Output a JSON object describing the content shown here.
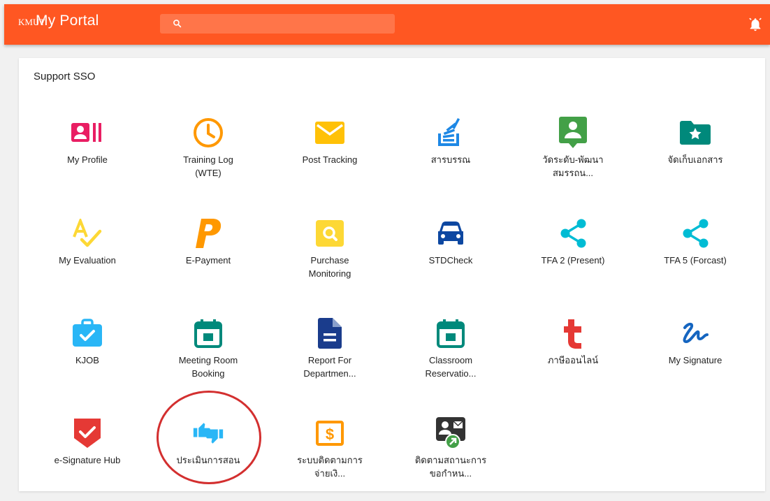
{
  "app": {
    "logo_mark": "KMUT",
    "title": "My Portal",
    "brand_color": "#ff5722"
  },
  "search": {
    "placeholder": ""
  },
  "section": {
    "title": "Support SSO"
  },
  "tiles": [
    {
      "l1": "My Profile",
      "l2": "",
      "icon": "profile-card-icon",
      "color": "#e91e63"
    },
    {
      "l1": "Training Log",
      "l2": "(WTE)",
      "icon": "clock-icon",
      "color": "#ff9800"
    },
    {
      "l1": "Post Tracking",
      "l2": "",
      "icon": "mail-icon",
      "color": "#ffc107"
    },
    {
      "l1": "สารบรรณ",
      "l2": "",
      "icon": "stack-icon",
      "color": "#1e88e5"
    },
    {
      "l1": "วัดระดับ-พัฒนา",
      "l2": "สมรรถน...",
      "icon": "person-pin-icon",
      "color": "#43a047"
    },
    {
      "l1": "จัดเก็บเอกสาร",
      "l2": "",
      "icon": "star-folder-icon",
      "color": "#00897b"
    },
    {
      "l1": "My Evaluation",
      "l2": "",
      "icon": "spellcheck-icon",
      "color": "#fdd835"
    },
    {
      "l1": "E-Payment",
      "l2": "",
      "icon": "p-letter-icon",
      "color": "#ff9800"
    },
    {
      "l1": "Purchase",
      "l2": "Monitoring",
      "icon": "search-box-icon",
      "color": "#fdd835"
    },
    {
      "l1": "STDCheck",
      "l2": "",
      "icon": "car-icon",
      "color": "#0d47a1"
    },
    {
      "l1": "TFA 2 (Present)",
      "l2": "",
      "icon": "share-icon",
      "color": "#00bcd4"
    },
    {
      "l1": "TFA 5 (Forcast)",
      "l2": "",
      "icon": "share-icon",
      "color": "#00bcd4"
    },
    {
      "l1": "KJOB",
      "l2": "",
      "icon": "briefcase-check-icon",
      "color": "#29b6f6"
    },
    {
      "l1": "Meeting Room",
      "l2": "Booking",
      "icon": "calendar-icon",
      "color": "#00897b"
    },
    {
      "l1": "Report For",
      "l2": "Departmen...",
      "icon": "document-icon",
      "color": "#1a3c8c"
    },
    {
      "l1": "Classroom",
      "l2": "Reservatio...",
      "icon": "calendar-icon",
      "color": "#00897b"
    },
    {
      "l1": "ภาษีออนไลน์",
      "l2": "",
      "icon": "t-letter-icon",
      "color": "#e53935"
    },
    {
      "l1": "My Signature",
      "l2": "",
      "icon": "signature-icon",
      "color": "#1565c0"
    },
    {
      "l1": "e-Signature Hub",
      "l2": "",
      "icon": "shield-check-icon",
      "color": "#e53935"
    },
    {
      "l1": "ประเมินการสอน",
      "l2": "",
      "icon": "thumbs-icon",
      "color": "#29b6f6"
    },
    {
      "l1": "ระบบติดตามการ",
      "l2": "จ่ายเงิ...",
      "icon": "dollar-box-icon",
      "color": "#ff9800"
    },
    {
      "l1": "ติดตามสถานะการ",
      "l2": "ขอกำหน...",
      "icon": "contact-mail-icon",
      "color": "#333333"
    }
  ]
}
